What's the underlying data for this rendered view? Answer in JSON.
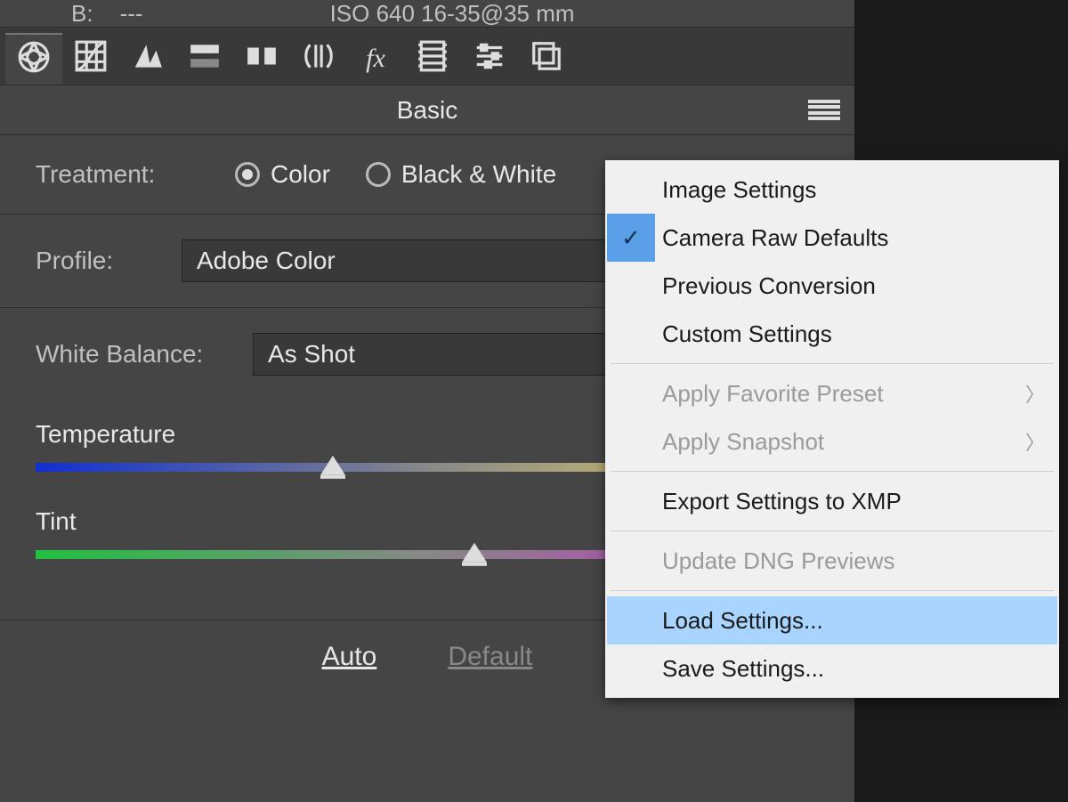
{
  "top_info": {
    "b_label": "B:",
    "b_value": "---",
    "exposure": "ISO 640   16-35@35 mm"
  },
  "tabs": [
    {
      "name": "edit-tab-icon",
      "active": true
    },
    {
      "name": "curve-tab-icon",
      "active": false
    },
    {
      "name": "detail-tab-icon",
      "active": false
    },
    {
      "name": "hsl-tab-icon",
      "active": false
    },
    {
      "name": "split-tab-icon",
      "active": false
    },
    {
      "name": "lens-tab-icon",
      "active": false
    },
    {
      "name": "fx-tab-icon",
      "active": false
    },
    {
      "name": "calibration-tab-icon",
      "active": false
    },
    {
      "name": "presets-tab-icon",
      "active": false
    },
    {
      "name": "snapshots-tab-icon",
      "active": false
    }
  ],
  "panel_title": "Basic",
  "treatment": {
    "label": "Treatment:",
    "options": [
      {
        "label": "Color",
        "selected": true
      },
      {
        "label": "Black & White",
        "selected": false
      }
    ]
  },
  "profile": {
    "label": "Profile:",
    "value": "Adobe Color"
  },
  "white_balance": {
    "label": "White Balance:",
    "value": "As Shot"
  },
  "sliders": {
    "temperature": {
      "label": "Temperature",
      "position_pct": 38
    },
    "tint": {
      "label": "Tint",
      "position_pct": 56
    }
  },
  "bottom_links": {
    "auto": {
      "label": "Auto",
      "enabled": true
    },
    "default": {
      "label": "Default",
      "enabled": false
    }
  },
  "menu": {
    "groups": [
      [
        {
          "label": "Image Settings",
          "enabled": true,
          "checked": false
        },
        {
          "label": "Camera Raw Defaults",
          "enabled": true,
          "checked": true
        },
        {
          "label": "Previous Conversion",
          "enabled": true,
          "checked": false
        },
        {
          "label": "Custom Settings",
          "enabled": true,
          "checked": false
        }
      ],
      [
        {
          "label": "Apply Favorite Preset",
          "enabled": false,
          "submenu": true
        },
        {
          "label": "Apply Snapshot",
          "enabled": false,
          "submenu": true
        }
      ],
      [
        {
          "label": "Export Settings to XMP",
          "enabled": true
        }
      ],
      [
        {
          "label": "Update DNG Previews",
          "enabled": false
        }
      ],
      [
        {
          "label": "Load Settings...",
          "enabled": true,
          "highlight": true
        },
        {
          "label": "Save Settings...",
          "enabled": true
        }
      ]
    ]
  }
}
